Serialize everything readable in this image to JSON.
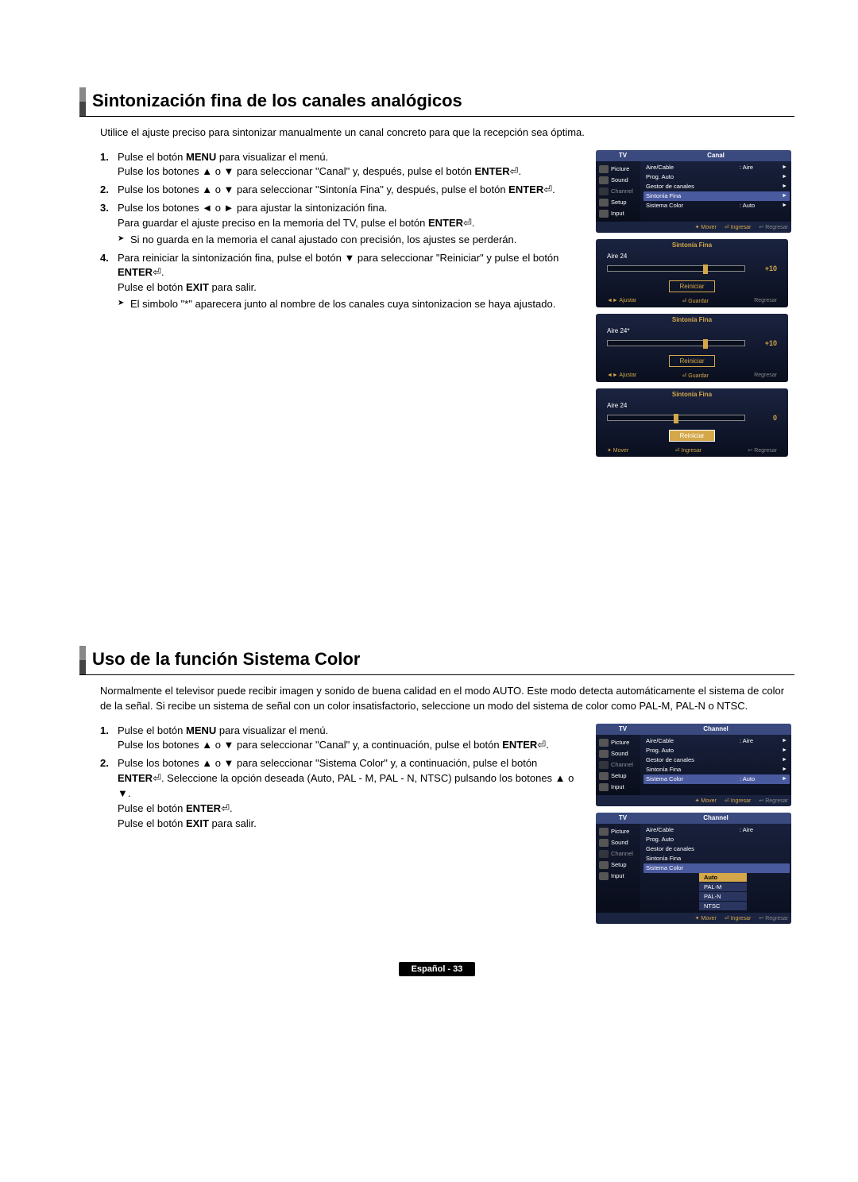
{
  "sec1": {
    "title": "Sintonización fina de los canales analógicos",
    "intro": "Utilice el ajuste preciso para sintonizar manualmente un canal concreto para que la recepción sea óptima.",
    "steps": [
      {
        "n": "1.",
        "body": "Pulse el botón <b>MENU</b> para visualizar el menú.<br>Pulse los botones ▲ o ▼ para seleccionar \"Canal\" y, después, pulse el botón <b>ENTER</b>⏎."
      },
      {
        "n": "2.",
        "body": "Pulse los botones ▲ o ▼ para seleccionar \"Sintonía Fina\" y, después, pulse el botón <b>ENTER</b>⏎."
      },
      {
        "n": "3.",
        "body": "Pulse los botones ◄ o ► para ajustar la sintonización fina.<br>Para guardar el ajuste preciso en la memoria del TV, pulse el botón <b>ENTER</b>⏎.",
        "sub": "Si no guarda en la memoria el canal ajustado con precisión, los ajustes se perderán."
      },
      {
        "n": "4.",
        "body": "Para reiniciar la sintonización fina, pulse el botón ▼ para seleccionar \"Reiniciar\" y pulse el botón <b>ENTER</b>⏎.<br>Pulse el botón <b>EXIT</b> para salir.",
        "sub": "El simbolo \"*\" aparecera junto al nombre de los canales cuya sintonizacion se haya ajustado."
      }
    ]
  },
  "sec2": {
    "title": "Uso de la función Sistema Color",
    "intro": "Normalmente el televisor puede recibir imagen y sonido de buena calidad en el modo AUTO. Este modo detecta automáticamente el sistema de color de la señal. Si recibe un sistema de señal con un color insatisfactorio, seleccione un modo del sistema de color como PAL-M, PAL-N o NTSC.",
    "steps": [
      {
        "n": "1.",
        "body": "Pulse el botón <b>MENU</b> para visualizar el menú.<br>Pulse los botones ▲ o ▼ para seleccionar \"Canal\" y, a continuación, pulse el botón <b>ENTER</b>⏎."
      },
      {
        "n": "2.",
        "body": "Pulse los botones ▲ o ▼ para seleccionar \"Sistema Color\" y, a continuación, pulse el botón <b>ENTER</b>⏎. Seleccione la opción deseada (Auto, PAL - M, PAL - N, NTSC) pulsando los botones ▲ o ▼.<br>Pulse el botón <b>ENTER</b>⏎.<br>Pulse el botón <b>EXIT</b> para salir."
      }
    ]
  },
  "osd_menu1": {
    "tv": "TV",
    "header": "Canal",
    "tabs": [
      "Picture",
      "Sound",
      "Channel",
      "Setup",
      "Input"
    ],
    "rows": [
      {
        "lbl": "Aire/Cable",
        "val": ": Aire",
        "chev": "►"
      },
      {
        "lbl": "Prog. Auto",
        "val": "",
        "chev": "►"
      },
      {
        "lbl": "Gestor de canales",
        "val": "",
        "chev": "►"
      },
      {
        "lbl": "Sintonía Fina",
        "val": "",
        "chev": "►",
        "hl": true
      },
      {
        "lbl": "Sistema Color",
        "val": ": Auto",
        "chev": "►"
      }
    ],
    "footer": {
      "a": "✦ Mover",
      "b": "⏎ Ingresar",
      "c": "↩ Regresar"
    }
  },
  "ft1": {
    "title": "Sintonía Fina",
    "ch": "Aire 24",
    "val": "+10",
    "thumb": 70,
    "reset": "Reiniciar",
    "footer": {
      "a": "◄► Ajustar",
      "b": "⏎ Guardar",
      "c": "Regresar"
    }
  },
  "ft2": {
    "title": "Sintonía Fina",
    "ch": "Aire 24*",
    "val": "+10",
    "thumb": 70,
    "reset": "Reiniciar",
    "footer": {
      "a": "◄► Ajustar",
      "b": "⏎ Guardar",
      "c": "Regresar"
    }
  },
  "ft3": {
    "title": "Sintonía Fina",
    "ch": "Aire 24",
    "val": "0",
    "thumb": 48,
    "reset": "Reiniciar",
    "reset_hl": true,
    "footer": {
      "a": "✦ Mover",
      "b": "⏎ Ingresar",
      "c": "↩ Regresar"
    }
  },
  "osd_menu2": {
    "tv": "TV",
    "header": "Channel",
    "tabs": [
      "Picture",
      "Sound",
      "Channel",
      "Setup",
      "Input"
    ],
    "rows": [
      {
        "lbl": "Aire/Cable",
        "val": ": Aire",
        "chev": "►"
      },
      {
        "lbl": "Prog. Auto",
        "val": "",
        "chev": "►"
      },
      {
        "lbl": "Gestor de canales",
        "val": "",
        "chev": "►"
      },
      {
        "lbl": "Sintonía Fina",
        "val": "",
        "chev": "►"
      },
      {
        "lbl": "Sistema Color",
        "val": ": Auto",
        "chev": "►",
        "hl": true
      }
    ],
    "footer": {
      "a": "✦ Mover",
      "b": "⏎ Ingresar",
      "c": "↩ Regresar"
    }
  },
  "osd_menu3": {
    "tv": "TV",
    "header": "Channel",
    "tabs": [
      "Picture",
      "Sound",
      "Channel",
      "Setup",
      "Input"
    ],
    "rows": [
      {
        "lbl": "Aire/Cable",
        "val": ": Aire",
        "chev": ""
      },
      {
        "lbl": "Prog. Auto",
        "val": "",
        "chev": ""
      },
      {
        "lbl": "Gestor de canales",
        "val": "",
        "chev": ""
      },
      {
        "lbl": "Sintonía Fina",
        "val": "",
        "chev": ""
      },
      {
        "lbl": "Sistema Color",
        "val": "",
        "chev": "",
        "hl": true
      }
    ],
    "opts": [
      "Auto",
      "PAL-M",
      "PAL-N",
      "NTSC"
    ],
    "footer": {
      "a": "✦ Mover",
      "b": "⏎ Ingresar",
      "c": "↩ Regresar"
    }
  },
  "footer": "Español - 33"
}
